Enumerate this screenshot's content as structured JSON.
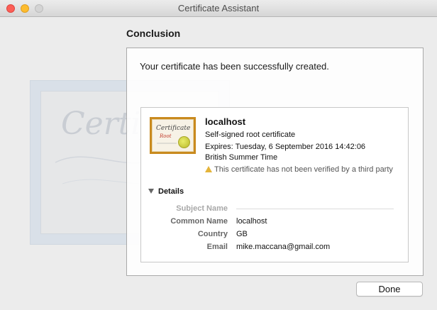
{
  "window": {
    "title": "Certificate Assistant"
  },
  "watermark": {
    "text": "Certificate"
  },
  "step": {
    "title": "Conclusion",
    "message": "Your certificate has been successfully created."
  },
  "certificate": {
    "icon_text": "Certificate",
    "icon_subtext": "Root",
    "name": "localhost",
    "type": "Self-signed root certificate",
    "expires_line1": "Expires: Tuesday, 6 September 2016 14:42:06",
    "expires_line2": "British Summer Time",
    "warning": "This certificate has not been verified by a third party"
  },
  "details": {
    "label": "Details",
    "section_title": "Subject Name",
    "fields": [
      {
        "label": "Common Name",
        "value": "localhost"
      },
      {
        "label": "Country",
        "value": "GB"
      },
      {
        "label": "Email",
        "value": "mike.maccana@gmail.com"
      }
    ]
  },
  "buttons": {
    "done": "Done"
  },
  "colors": {
    "close": "#fc5f57",
    "minimize": "#fdbc2e",
    "zoom": "#d4d4d4",
    "cert_frame": "#c98a1e",
    "warning": "#e4b43a"
  }
}
